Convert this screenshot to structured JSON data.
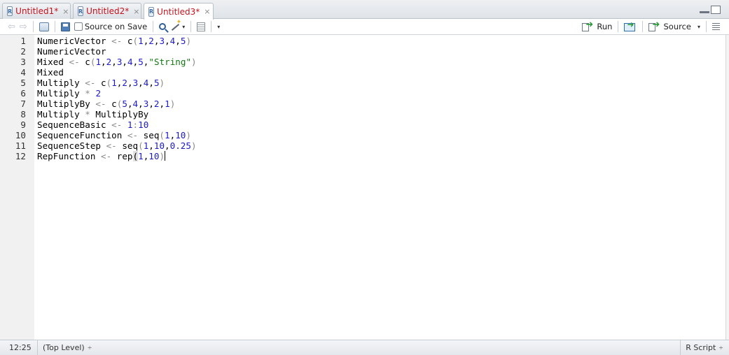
{
  "tabs": [
    {
      "label": "Untitled1*",
      "close": "×"
    },
    {
      "label": "Untitled2*",
      "close": "×"
    },
    {
      "label": "Untitled3*",
      "close": "×",
      "active": true
    }
  ],
  "toolbar": {
    "source_on_save_label": "Source on Save",
    "run_label": "Run",
    "source_label": "Source"
  },
  "editor": {
    "lines": [
      {
        "n": "1",
        "code": [
          [
            "t",
            "NumericVector "
          ],
          [
            "o",
            "<-"
          ],
          [
            "t",
            " c"
          ],
          [
            "o",
            "("
          ],
          [
            "n",
            "1"
          ],
          [
            "t",
            ","
          ],
          [
            "n",
            "2"
          ],
          [
            "t",
            ","
          ],
          [
            "n",
            "3"
          ],
          [
            "t",
            ","
          ],
          [
            "n",
            "4"
          ],
          [
            "t",
            ","
          ],
          [
            "n",
            "5"
          ],
          [
            "o",
            ")"
          ]
        ]
      },
      {
        "n": "2",
        "code": [
          [
            "t",
            "NumericVector"
          ]
        ]
      },
      {
        "n": "3",
        "code": [
          [
            "t",
            "Mixed "
          ],
          [
            "o",
            "<-"
          ],
          [
            "t",
            " c"
          ],
          [
            "o",
            "("
          ],
          [
            "n",
            "1"
          ],
          [
            "t",
            ","
          ],
          [
            "n",
            "2"
          ],
          [
            "t",
            ","
          ],
          [
            "n",
            "3"
          ],
          [
            "t",
            ","
          ],
          [
            "n",
            "4"
          ],
          [
            "t",
            ","
          ],
          [
            "n",
            "5"
          ],
          [
            "t",
            ","
          ],
          [
            "s",
            "\"String\""
          ],
          [
            "o",
            ")"
          ]
        ]
      },
      {
        "n": "4",
        "code": [
          [
            "t",
            "Mixed"
          ]
        ]
      },
      {
        "n": "5",
        "code": [
          [
            "t",
            "Multiply "
          ],
          [
            "o",
            "<-"
          ],
          [
            "t",
            " c"
          ],
          [
            "o",
            "("
          ],
          [
            "n",
            "1"
          ],
          [
            "t",
            ","
          ],
          [
            "n",
            "2"
          ],
          [
            "t",
            ","
          ],
          [
            "n",
            "3"
          ],
          [
            "t",
            ","
          ],
          [
            "n",
            "4"
          ],
          [
            "t",
            ","
          ],
          [
            "n",
            "5"
          ],
          [
            "o",
            ")"
          ]
        ]
      },
      {
        "n": "6",
        "code": [
          [
            "t",
            "Multiply "
          ],
          [
            "o",
            "*"
          ],
          [
            "t",
            " "
          ],
          [
            "n",
            "2"
          ]
        ]
      },
      {
        "n": "7",
        "code": [
          [
            "t",
            "MultiplyBy "
          ],
          [
            "o",
            "<-"
          ],
          [
            "t",
            " c"
          ],
          [
            "o",
            "("
          ],
          [
            "n",
            "5"
          ],
          [
            "t",
            ","
          ],
          [
            "n",
            "4"
          ],
          [
            "t",
            ","
          ],
          [
            "n",
            "3"
          ],
          [
            "t",
            ","
          ],
          [
            "n",
            "2"
          ],
          [
            "t",
            ","
          ],
          [
            "n",
            "1"
          ],
          [
            "o",
            ")"
          ]
        ]
      },
      {
        "n": "8",
        "code": [
          [
            "t",
            "Multiply "
          ],
          [
            "o",
            "*"
          ],
          [
            "t",
            " MultiplyBy"
          ]
        ]
      },
      {
        "n": "9",
        "code": [
          [
            "t",
            "SequenceBasic "
          ],
          [
            "o",
            "<-"
          ],
          [
            "t",
            " "
          ],
          [
            "n",
            "1"
          ],
          [
            "o",
            ":"
          ],
          [
            "n",
            "10"
          ]
        ]
      },
      {
        "n": "10",
        "code": [
          [
            "t",
            "SequenceFunction "
          ],
          [
            "o",
            "<-"
          ],
          [
            "t",
            " seq"
          ],
          [
            "o",
            "("
          ],
          [
            "n",
            "1"
          ],
          [
            "t",
            ","
          ],
          [
            "n",
            "10"
          ],
          [
            "o",
            ")"
          ]
        ]
      },
      {
        "n": "11",
        "code": [
          [
            "t",
            "SequenceStep "
          ],
          [
            "o",
            "<-"
          ],
          [
            "t",
            " seq"
          ],
          [
            "o",
            "("
          ],
          [
            "n",
            "1"
          ],
          [
            "t",
            ","
          ],
          [
            "n",
            "10"
          ],
          [
            "t",
            ","
          ],
          [
            "n",
            "0.25"
          ],
          [
            "o",
            ")"
          ]
        ]
      },
      {
        "n": "12",
        "code": [
          [
            "t",
            "RepFunction "
          ],
          [
            "o",
            "<-"
          ],
          [
            "t",
            " rep"
          ],
          [
            "h",
            "("
          ],
          [
            "n",
            "1"
          ],
          [
            "t",
            ","
          ],
          [
            "n",
            "10"
          ],
          [
            "o",
            ")"
          ],
          [
            "c",
            ""
          ]
        ]
      }
    ]
  },
  "status": {
    "cursor_position": "12:25",
    "scope": "(Top Level)",
    "file_type": "R Script",
    "updown": "÷"
  },
  "icons": {
    "back": "⇦",
    "forward": "⇨",
    "caret": "▾"
  }
}
